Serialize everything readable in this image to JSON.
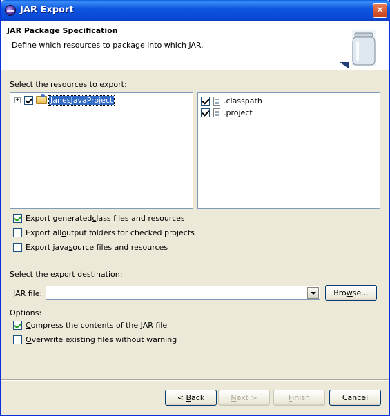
{
  "window": {
    "title": "JAR Export",
    "close_glyph": "✕"
  },
  "header": {
    "title": "JAR Package Specification",
    "description": "Define which resources to package into which JAR."
  },
  "resources": {
    "label_before": "Select the resources to ",
    "label_accel": "e",
    "label_after": "xport:",
    "tree": [
      {
        "label": "JanesJavaProject",
        "checked": true,
        "expanded": false,
        "selected": true,
        "icon": "folder-icon"
      }
    ],
    "files": [
      {
        "label": ".classpath",
        "checked": true,
        "icon": "file-icon"
      },
      {
        "label": ".project",
        "checked": true,
        "icon": "file-icon"
      }
    ]
  },
  "export_options": [
    {
      "before": "Export generated ",
      "accel": "c",
      "after": "lass files and resources",
      "checked": true
    },
    {
      "before": "Export all ",
      "accel": "o",
      "after": "utput folders for checked projects",
      "checked": false
    },
    {
      "before": "Export java ",
      "accel": "s",
      "after": "ource files and resources",
      "checked": false
    }
  ],
  "destination": {
    "label": "Select the export destination:",
    "jar_label_accel": "J",
    "jar_label_rest": "AR file:",
    "jar_value": "",
    "browse_label_accel": "w",
    "browse_label_before": "Bro",
    "browse_label_after": "se..."
  },
  "options": {
    "label": "Options:",
    "items": [
      {
        "before": "",
        "accel": "C",
        "after": "ompress the contents of the JAR file",
        "checked": true
      },
      {
        "before": "",
        "accel": "O",
        "after": "verwrite existing files without warning",
        "checked": false
      }
    ]
  },
  "buttons": {
    "back": {
      "before": "< ",
      "accel": "B",
      "after": "ack",
      "enabled": true
    },
    "next": {
      "before": "",
      "accel": "N",
      "after": "ext >",
      "enabled": false
    },
    "finish": {
      "before": "",
      "accel": "F",
      "after": "inish",
      "enabled": false
    },
    "cancel": {
      "label": "Cancel",
      "enabled": true
    }
  }
}
